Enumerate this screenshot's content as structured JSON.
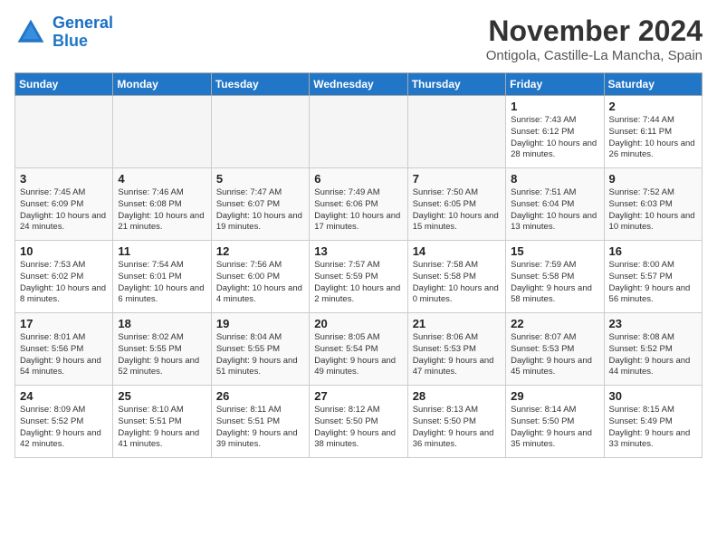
{
  "logo": {
    "line1": "General",
    "line2": "Blue"
  },
  "title": "November 2024",
  "location": "Ontigola, Castille-La Mancha, Spain",
  "weekdays": [
    "Sunday",
    "Monday",
    "Tuesday",
    "Wednesday",
    "Thursday",
    "Friday",
    "Saturday"
  ],
  "weeks": [
    [
      {
        "day": "",
        "empty": true
      },
      {
        "day": "",
        "empty": true
      },
      {
        "day": "",
        "empty": true
      },
      {
        "day": "",
        "empty": true
      },
      {
        "day": "",
        "empty": true
      },
      {
        "day": "1",
        "sunrise": "7:43 AM",
        "sunset": "6:12 PM",
        "daylight": "10 hours and 28 minutes."
      },
      {
        "day": "2",
        "sunrise": "7:44 AM",
        "sunset": "6:11 PM",
        "daylight": "10 hours and 26 minutes."
      }
    ],
    [
      {
        "day": "3",
        "sunrise": "7:45 AM",
        "sunset": "6:09 PM",
        "daylight": "10 hours and 24 minutes."
      },
      {
        "day": "4",
        "sunrise": "7:46 AM",
        "sunset": "6:08 PM",
        "daylight": "10 hours and 21 minutes."
      },
      {
        "day": "5",
        "sunrise": "7:47 AM",
        "sunset": "6:07 PM",
        "daylight": "10 hours and 19 minutes."
      },
      {
        "day": "6",
        "sunrise": "7:49 AM",
        "sunset": "6:06 PM",
        "daylight": "10 hours and 17 minutes."
      },
      {
        "day": "7",
        "sunrise": "7:50 AM",
        "sunset": "6:05 PM",
        "daylight": "10 hours and 15 minutes."
      },
      {
        "day": "8",
        "sunrise": "7:51 AM",
        "sunset": "6:04 PM",
        "daylight": "10 hours and 13 minutes."
      },
      {
        "day": "9",
        "sunrise": "7:52 AM",
        "sunset": "6:03 PM",
        "daylight": "10 hours and 10 minutes."
      }
    ],
    [
      {
        "day": "10",
        "sunrise": "7:53 AM",
        "sunset": "6:02 PM",
        "daylight": "10 hours and 8 minutes."
      },
      {
        "day": "11",
        "sunrise": "7:54 AM",
        "sunset": "6:01 PM",
        "daylight": "10 hours and 6 minutes."
      },
      {
        "day": "12",
        "sunrise": "7:56 AM",
        "sunset": "6:00 PM",
        "daylight": "10 hours and 4 minutes."
      },
      {
        "day": "13",
        "sunrise": "7:57 AM",
        "sunset": "5:59 PM",
        "daylight": "10 hours and 2 minutes."
      },
      {
        "day": "14",
        "sunrise": "7:58 AM",
        "sunset": "5:58 PM",
        "daylight": "10 hours and 0 minutes."
      },
      {
        "day": "15",
        "sunrise": "7:59 AM",
        "sunset": "5:58 PM",
        "daylight": "9 hours and 58 minutes."
      },
      {
        "day": "16",
        "sunrise": "8:00 AM",
        "sunset": "5:57 PM",
        "daylight": "9 hours and 56 minutes."
      }
    ],
    [
      {
        "day": "17",
        "sunrise": "8:01 AM",
        "sunset": "5:56 PM",
        "daylight": "9 hours and 54 minutes."
      },
      {
        "day": "18",
        "sunrise": "8:02 AM",
        "sunset": "5:55 PM",
        "daylight": "9 hours and 52 minutes."
      },
      {
        "day": "19",
        "sunrise": "8:04 AM",
        "sunset": "5:55 PM",
        "daylight": "9 hours and 51 minutes."
      },
      {
        "day": "20",
        "sunrise": "8:05 AM",
        "sunset": "5:54 PM",
        "daylight": "9 hours and 49 minutes."
      },
      {
        "day": "21",
        "sunrise": "8:06 AM",
        "sunset": "5:53 PM",
        "daylight": "9 hours and 47 minutes."
      },
      {
        "day": "22",
        "sunrise": "8:07 AM",
        "sunset": "5:53 PM",
        "daylight": "9 hours and 45 minutes."
      },
      {
        "day": "23",
        "sunrise": "8:08 AM",
        "sunset": "5:52 PM",
        "daylight": "9 hours and 44 minutes."
      }
    ],
    [
      {
        "day": "24",
        "sunrise": "8:09 AM",
        "sunset": "5:52 PM",
        "daylight": "9 hours and 42 minutes."
      },
      {
        "day": "25",
        "sunrise": "8:10 AM",
        "sunset": "5:51 PM",
        "daylight": "9 hours and 41 minutes."
      },
      {
        "day": "26",
        "sunrise": "8:11 AM",
        "sunset": "5:51 PM",
        "daylight": "9 hours and 39 minutes."
      },
      {
        "day": "27",
        "sunrise": "8:12 AM",
        "sunset": "5:50 PM",
        "daylight": "9 hours and 38 minutes."
      },
      {
        "day": "28",
        "sunrise": "8:13 AM",
        "sunset": "5:50 PM",
        "daylight": "9 hours and 36 minutes."
      },
      {
        "day": "29",
        "sunrise": "8:14 AM",
        "sunset": "5:50 PM",
        "daylight": "9 hours and 35 minutes."
      },
      {
        "day": "30",
        "sunrise": "8:15 AM",
        "sunset": "5:49 PM",
        "daylight": "9 hours and 33 minutes."
      }
    ]
  ]
}
